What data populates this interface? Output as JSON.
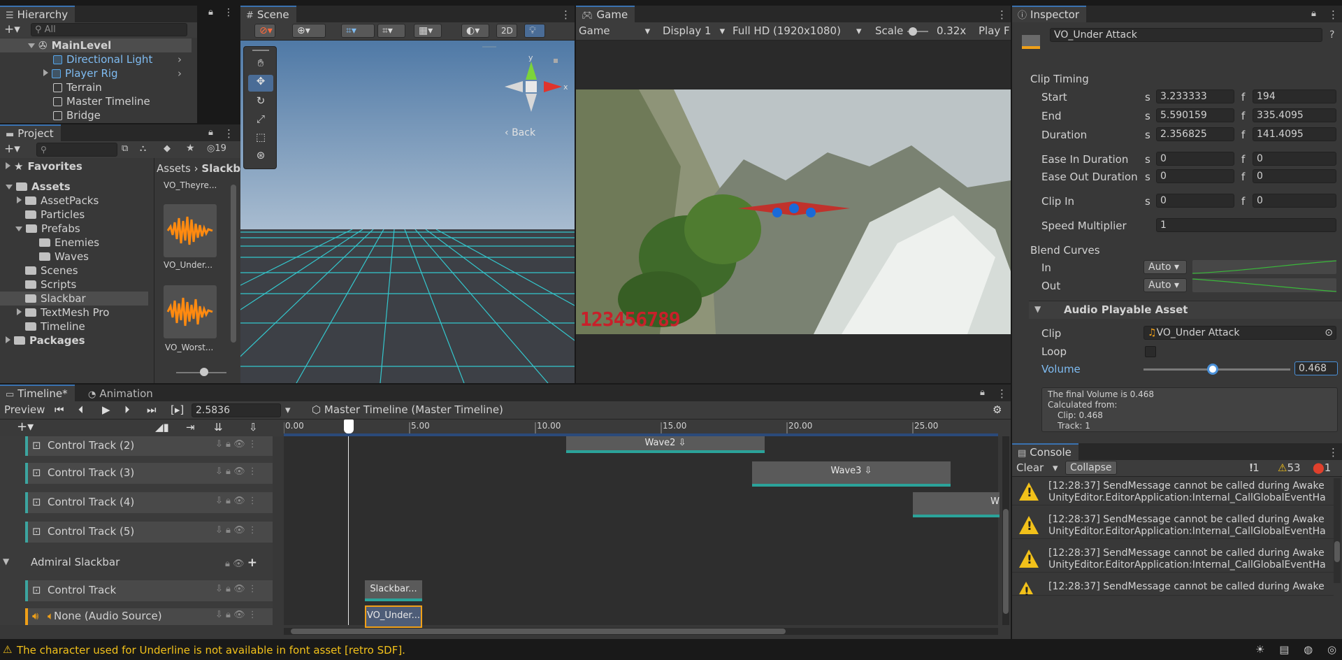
{
  "hierarchy": {
    "tab": "Hierarchy",
    "search_placeholder": "All",
    "root": "MainLevel",
    "items": [
      "Directional Light",
      "Player Rig",
      "Terrain",
      "Master Timeline",
      "Bridge"
    ]
  },
  "project": {
    "tab": "Project",
    "count": "19",
    "favorites": "Favorites",
    "assets": "Assets",
    "folders": [
      "AssetPacks",
      "Particles",
      "Prefabs",
      "Enemies",
      "Waves",
      "Scenes",
      "Scripts",
      "Slackbar",
      "TextMesh Pro",
      "Timeline"
    ],
    "packages": "Packages",
    "breadcrumb_root": "Assets",
    "breadcrumb_current": "Slackb",
    "files": [
      "VO_Theyre...",
      "VO_Under...",
      "VO_Worst..."
    ]
  },
  "scene": {
    "tab": "Scene",
    "btn_2d": "2D",
    "back": "Back",
    "axis_x": "x",
    "axis_y": "y"
  },
  "game": {
    "tab": "Game",
    "display_mode": "Game",
    "display": "Display 1",
    "resolution": "Full HD (1920x1080)",
    "scale_label": "Scale",
    "scale_value": "0.32x",
    "play_label": "Play F",
    "hud_digits": "123456789"
  },
  "inspector": {
    "tab": "Inspector",
    "name": "VO_Under Attack",
    "clip_timing": "Clip Timing",
    "rows": [
      {
        "label": "Start",
        "s": "3.233333",
        "f": "194"
      },
      {
        "label": "End",
        "s": "5.590159",
        "f": "335.4095"
      },
      {
        "label": "Duration",
        "s": "2.356825",
        "f": "141.4095"
      },
      {
        "label": "Ease In Duration",
        "s": "0",
        "f": "0"
      },
      {
        "label": "Ease Out Duration",
        "s": "0",
        "f": "0"
      },
      {
        "label": "Clip In",
        "s": "0",
        "f": "0"
      }
    ],
    "s_unit": "s",
    "f_unit": "f",
    "speed_label": "Speed Multiplier",
    "speed_value": "1",
    "blend_curves": "Blend Curves",
    "in_label": "In",
    "out_label": "Out",
    "auto": "Auto",
    "audio_asset": "Audio Playable Asset",
    "clip_label": "Clip",
    "clip_value": "VO_Under Attack",
    "loop_label": "Loop",
    "volume_label": "Volume",
    "volume_value": "0.468",
    "volume_fraction": 0.468,
    "info_lines": [
      "The final Volume is 0.468",
      "Calculated from:",
      "Clip: 0.468",
      "Track: 1"
    ]
  },
  "timeline": {
    "tab": "Timeline*",
    "tab2": "Animation",
    "preview": "Preview",
    "time": "2.5836",
    "asset": "Master Timeline (Master Timeline)",
    "ruler": [
      "0.00",
      "5.00",
      "10.00",
      "15.00",
      "20.00",
      "25.00"
    ],
    "tracks": [
      "Control Track (2)",
      "Control Track (3)",
      "Control Track (4)",
      "Control Track (5)"
    ],
    "group": "Admiral Slackbar",
    "control_track": "Control Track",
    "audio_track": "None (Audio Source)",
    "clips": [
      "Wave2",
      "Wave3",
      "W",
      "Slackbar...",
      "VO_Under..."
    ]
  },
  "console": {
    "tab": "Console",
    "clear": "Clear",
    "collapse": "Collapse",
    "count_info": "1",
    "count_warn": "53",
    "count_err": "1",
    "rows": [
      {
        "l1": "[12:28:37] SendMessage cannot be called during Awake",
        "l2": "UnityEditor.EditorApplication:Internal_CallGlobalEventHa"
      },
      {
        "l1": "[12:28:37] SendMessage cannot be called during Awake",
        "l2": "UnityEditor.EditorApplication:Internal_CallGlobalEventHa"
      },
      {
        "l1": "[12:28:37] SendMessage cannot be called during Awake",
        "l2": "UnityEditor.EditorApplication:Internal_CallGlobalEventHa"
      },
      {
        "l1": "[12:28:37] SendMessage cannot be called during Awake",
        "l2": ""
      }
    ]
  },
  "status": {
    "message": "The character used for Underline is not available in font asset [retro SDF]."
  },
  "colors": {
    "accent": "#3a72b0",
    "track": "#2ba39a",
    "warning": "#f2c11a",
    "audio": "#f0a018"
  }
}
